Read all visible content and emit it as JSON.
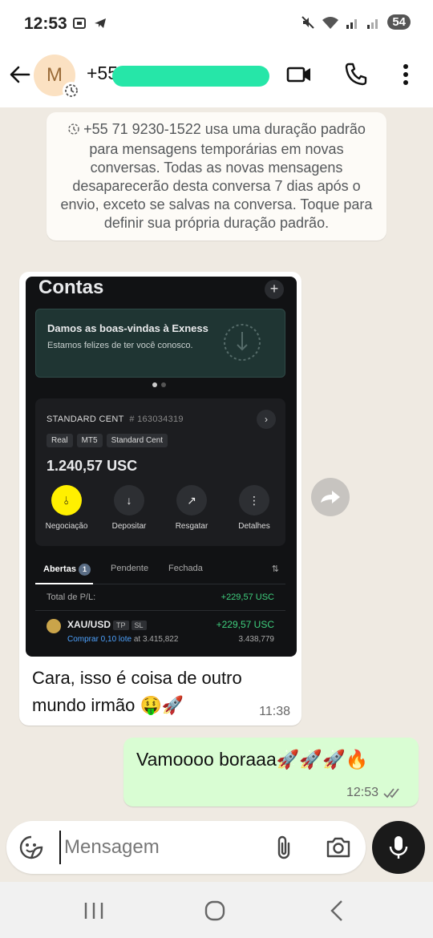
{
  "status_bar": {
    "time": "12:53",
    "battery": "54"
  },
  "header": {
    "avatar_initial": "M",
    "contact_name": "+55"
  },
  "system_message": {
    "text": "+55 71 9230-1522 usa uma duração padrão para mensagens temporárias em novas conversas. Todas as novas mensagens desaparecerão desta conversa 7 dias após o envio, exceto se salvas na conversa. Toque para definir sua própria duração padrão."
  },
  "incoming": {
    "caption": "Cara, isso é coisa de outro mundo irmão 🤑🚀",
    "time": "11:38",
    "screenshot": {
      "title": "Contas",
      "plus": "+",
      "welcome_title": "Damos as boas-vindas à Exness",
      "welcome_sub": "Estamos felizes de ter você conosco.",
      "account_name": "STANDARD CENT",
      "account_number": "# 163034319",
      "tags": [
        "Real",
        "MT5",
        "Standard Cent"
      ],
      "balance": "1.240,57 USC",
      "actions": [
        "Negociação",
        "Depositar",
        "Resgatar",
        "Detalhes"
      ],
      "tabs": {
        "open": "Abertas",
        "open_count": "1",
        "pending": "Pendente",
        "closed": "Fechada"
      },
      "pl_label": "Total de P/L:",
      "pl_value": "+229,57 USC",
      "position": {
        "symbol": "XAU/USD",
        "tp": "TP",
        "sl": "SL",
        "profit": "+229,57 USC",
        "action": "Comprar 0,10 lote",
        "open_text": "at 3.415,822",
        "current_price": "3.438,779"
      }
    }
  },
  "outgoing": {
    "text": "Vamoooo boraaa🚀🚀🚀🔥",
    "time": "12:53"
  },
  "input": {
    "placeholder": "Mensagem"
  },
  "colors": {
    "incoming_bg": "#ffffff",
    "outgoing_bg": "#d9fdd3",
    "chat_bg": "#efeae2",
    "redaction": "#26e6a8"
  }
}
